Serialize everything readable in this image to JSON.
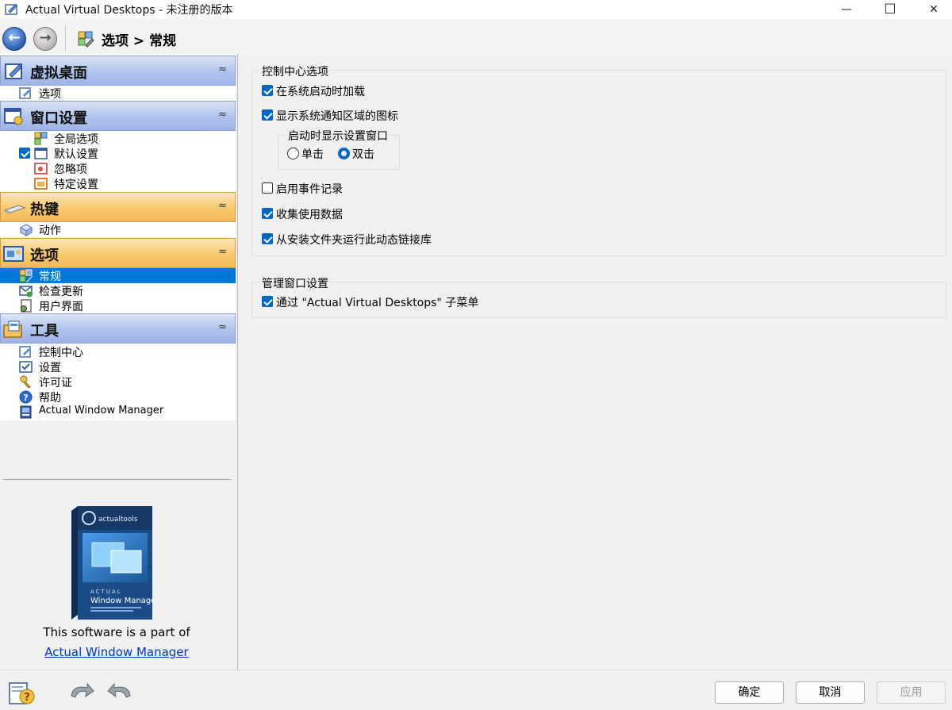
{
  "window": {
    "title": "Actual Virtual Desktops - 未注册的版本",
    "minimize_glyph": "—",
    "maximize_glyph": "☐",
    "close_glyph": "✕"
  },
  "toolbar": {
    "back_glyph": "←",
    "forward_glyph": "→",
    "breadcrumb": "选项 > 常规"
  },
  "sidebar": {
    "groups": [
      {
        "label": "虚拟桌面",
        "collapse_glyph": "≈",
        "items": [
          {
            "label": "选项",
            "icon": "control-center-icon"
          }
        ]
      },
      {
        "label": "窗口设置",
        "collapse_glyph": "≈",
        "items": [
          {
            "label": "全局选项",
            "icon": "global-options-icon"
          },
          {
            "label": "默认设置",
            "icon": "default-settings-icon"
          },
          {
            "label": "忽略项",
            "icon": "ignore-list-icon"
          },
          {
            "label": "特定设置",
            "icon": "specific-settings-icon"
          }
        ]
      },
      {
        "label": "热键",
        "collapse_glyph": "≈",
        "items": [
          {
            "label": "动作",
            "icon": "actions-icon"
          }
        ]
      },
      {
        "label": "选项",
        "collapse_glyph": "≈",
        "items": [
          {
            "label": "常规",
            "icon": "general-icon",
            "selected": true
          },
          {
            "label": "检查更新",
            "icon": "check-updates-icon"
          },
          {
            "label": "用户界面",
            "icon": "user-interface-icon"
          }
        ]
      },
      {
        "label": "工具",
        "collapse_glyph": "≈",
        "items": [
          {
            "label": "控制中心",
            "icon": "control-center-icon"
          },
          {
            "label": "设置",
            "icon": "settings-icon"
          },
          {
            "label": "许可证",
            "icon": "license-icon"
          },
          {
            "label": "帮助",
            "icon": "help-icon"
          },
          {
            "label": "Actual Window Manager",
            "icon": "window-manager-icon"
          }
        ]
      }
    ],
    "promo": {
      "box_brand": "actualtools",
      "box_small": "ACTUAL",
      "box_name": "Window Manager",
      "text": "This software is a part of",
      "link": "Actual Window Manager"
    }
  },
  "main": {
    "control_center": {
      "title": "控制中心选项",
      "load_on_startup": {
        "label": "在系统启动时加载",
        "checked": true
      },
      "show_tray_icon": {
        "label": "显示系统通知区域的图标",
        "checked": true
      },
      "open_settings": {
        "title": "启动时显示设置窗口",
        "single_click": {
          "label": "单击",
          "selected": false
        },
        "double_click": {
          "label": "双击",
          "selected": true
        }
      },
      "event_log": {
        "label": "启用事件记录",
        "checked": false
      },
      "collect_usage": {
        "label": "收集使用数据",
        "checked": true
      },
      "run_dll": {
        "label": "从安装文件夹运行此动态链接库",
        "checked": true
      }
    },
    "window_management": {
      "title": "管理窗口设置",
      "submenu": {
        "label": "通过 \"Actual Virtual Desktops\" 子菜单",
        "checked": true
      }
    }
  },
  "bottom": {
    "ok": "确定",
    "cancel": "取消",
    "apply": "应用"
  }
}
